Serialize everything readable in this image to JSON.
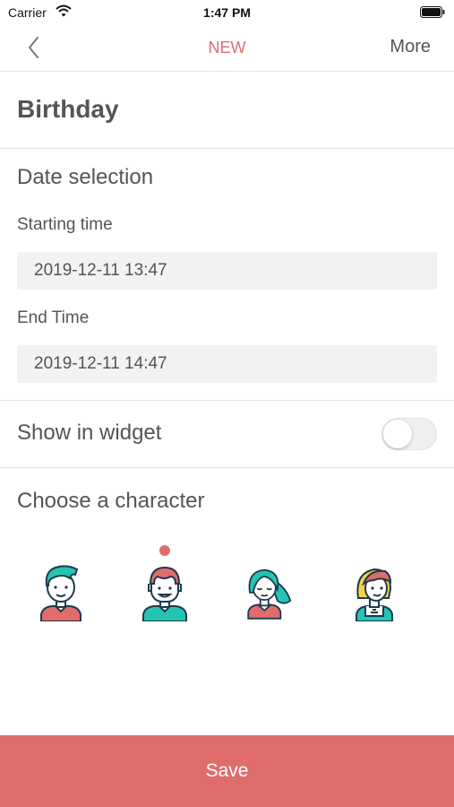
{
  "status_bar": {
    "carrier": "Carrier",
    "time": "1:47 PM"
  },
  "nav": {
    "title": "NEW",
    "more_label": "More"
  },
  "event": {
    "title": "Birthday"
  },
  "date_selection": {
    "heading": "Date selection",
    "start_label": "Starting time",
    "start_value": "2019-12-11 13:47",
    "end_label": "End Time",
    "end_value": "2019-12-11 14:47"
  },
  "widget": {
    "label": "Show in widget",
    "enabled": false
  },
  "characters": {
    "heading": "Choose a character",
    "selected_index": 1,
    "items": [
      {
        "name": "boy-teal-hair-icon"
      },
      {
        "name": "boy-pink-hair-icon"
      },
      {
        "name": "girl-teal-hair-icon"
      },
      {
        "name": "girl-blonde-hair-icon"
      }
    ]
  },
  "save_label": "Save",
  "colors": {
    "accent": "#e06c6c",
    "teal": "#24c4b4",
    "outline": "#1e3a4c",
    "blonde": "#f6d348"
  }
}
